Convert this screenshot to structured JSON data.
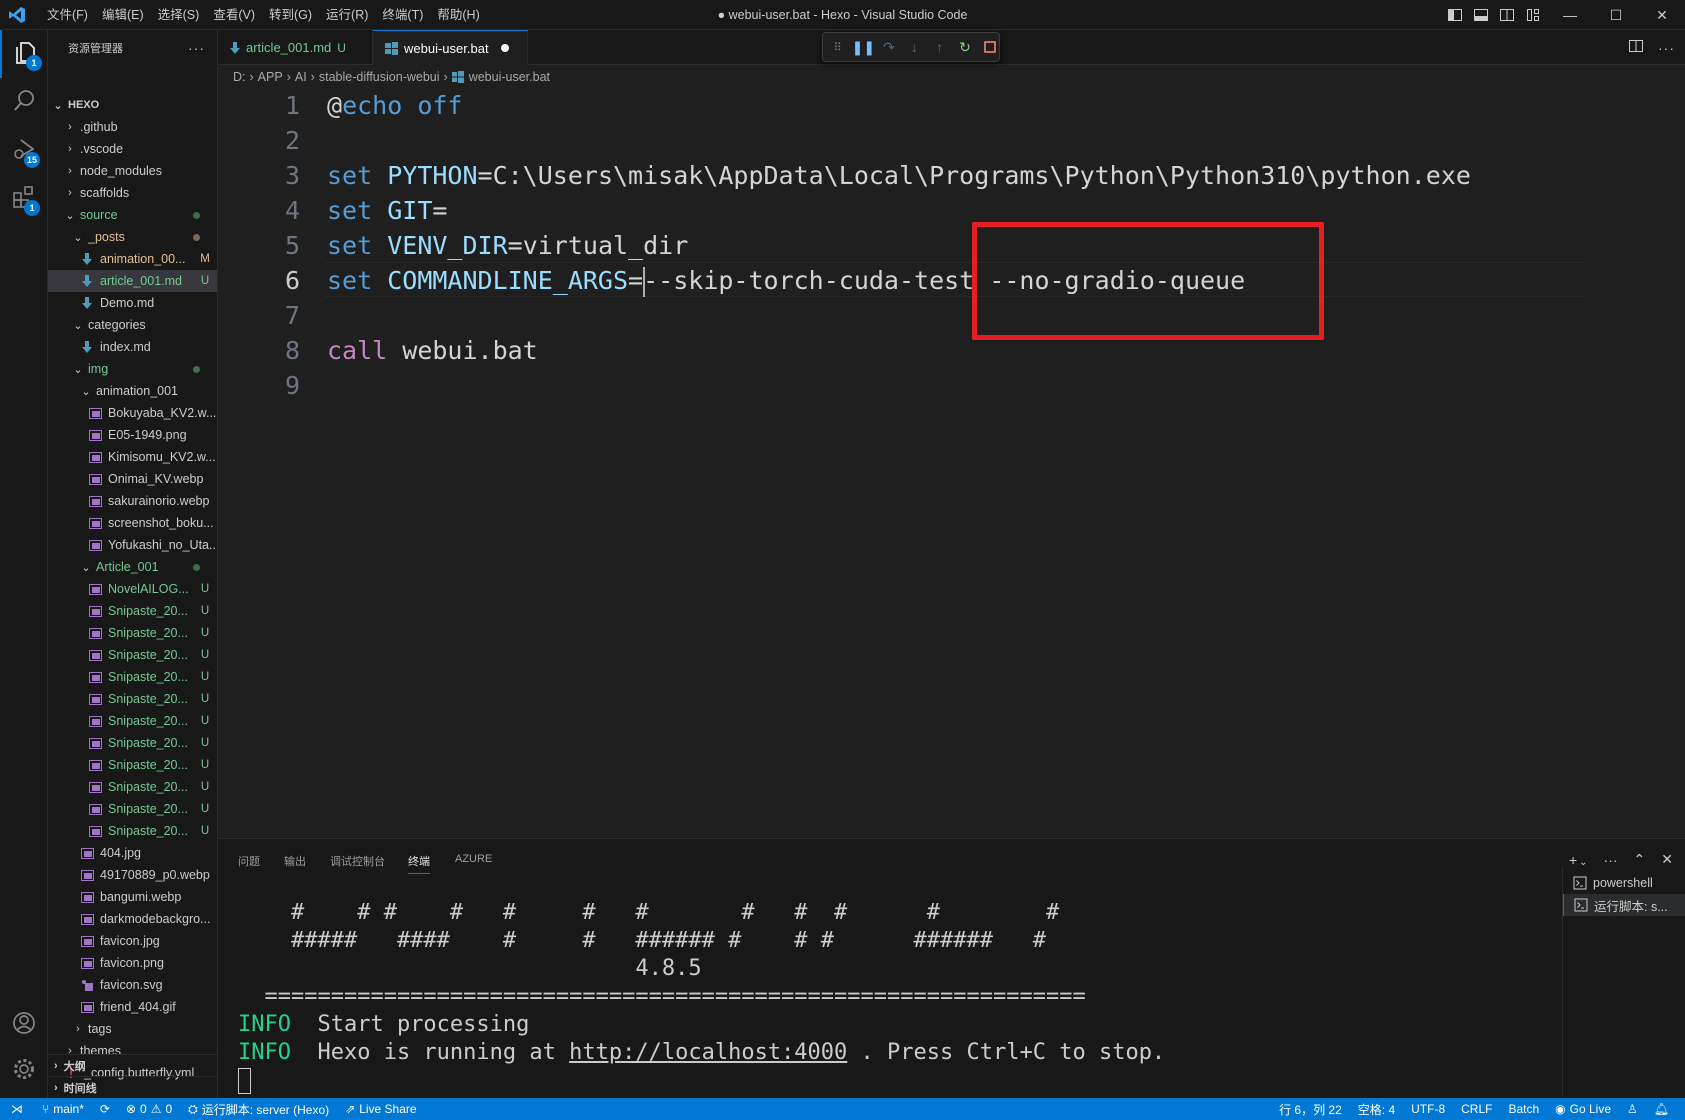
{
  "titlebar": {
    "menu": [
      "文件(F)",
      "编辑(E)",
      "选择(S)",
      "查看(V)",
      "转到(G)",
      "运行(R)",
      "终端(T)",
      "帮助(H)"
    ],
    "window_title": "● webui-user.bat - Hexo - Visual Studio Code",
    "controls": {
      "minimize": "—",
      "maximize": "☐",
      "close": "✕"
    }
  },
  "activitybar": {
    "items": [
      {
        "icon": "files-icon",
        "badge": "1"
      },
      {
        "icon": "search-icon",
        "badge": ""
      },
      {
        "icon": "run-debug-icon",
        "badge": "15"
      },
      {
        "icon": "extensions-icon",
        "badge": "1"
      }
    ],
    "bottom": [
      {
        "icon": "account-icon"
      },
      {
        "icon": "gear-icon"
      }
    ]
  },
  "sidebar": {
    "title": "资源管理器",
    "more": "···",
    "root": "HEXO",
    "tree": [
      {
        "label": ".github",
        "type": "folder",
        "open": false,
        "depth": 1
      },
      {
        "label": ".vscode",
        "type": "folder",
        "open": false,
        "depth": 1
      },
      {
        "label": "node_modules",
        "type": "folder",
        "open": false,
        "depth": 1
      },
      {
        "label": "scaffolds",
        "type": "folder",
        "open": false,
        "depth": 1
      },
      {
        "label": "source",
        "type": "folder",
        "open": true,
        "depth": 1,
        "color": "green",
        "dot": "green"
      },
      {
        "label": "_posts",
        "type": "folder",
        "open": true,
        "depth": 2,
        "color": "yellow",
        "dot": "yellow"
      },
      {
        "label": "animation_00...",
        "type": "md",
        "depth": 3,
        "color": "yellow",
        "status": "M"
      },
      {
        "label": "article_001.md",
        "type": "md",
        "depth": 3,
        "color": "green",
        "status": "U",
        "selected": true
      },
      {
        "label": "Demo.md",
        "type": "md",
        "depth": 3
      },
      {
        "label": "categories",
        "type": "folder",
        "open": true,
        "depth": 2
      },
      {
        "label": "index.md",
        "type": "md",
        "depth": 3
      },
      {
        "label": "img",
        "type": "folder",
        "open": true,
        "depth": 2,
        "color": "green",
        "dot": "green"
      },
      {
        "label": "animation_001",
        "type": "folder",
        "open": true,
        "depth": 3
      },
      {
        "label": "Bokuyaba_KV2.w...",
        "type": "image",
        "depth": 4
      },
      {
        "label": "E05-1949.png",
        "type": "image",
        "depth": 4
      },
      {
        "label": "Kimisomu_KV2.w...",
        "type": "image",
        "depth": 4
      },
      {
        "label": "Onimai_KV.webp",
        "type": "image",
        "depth": 4
      },
      {
        "label": "sakurainorio.webp",
        "type": "image",
        "depth": 4
      },
      {
        "label": "screenshot_boku...",
        "type": "image",
        "depth": 4
      },
      {
        "label": "Yofukashi_no_Uta...",
        "type": "image",
        "depth": 4
      },
      {
        "label": "Article_001",
        "type": "folder",
        "open": true,
        "depth": 3,
        "color": "green",
        "dot": "green"
      },
      {
        "label": "NovelAILOG...",
        "type": "image",
        "depth": 4,
        "color": "green",
        "status": "U"
      },
      {
        "label": "Snipaste_20...",
        "type": "image",
        "depth": 4,
        "color": "green",
        "status": "U"
      },
      {
        "label": "Snipaste_20...",
        "type": "image",
        "depth": 4,
        "color": "green",
        "status": "U"
      },
      {
        "label": "Snipaste_20...",
        "type": "image",
        "depth": 4,
        "color": "green",
        "status": "U"
      },
      {
        "label": "Snipaste_20...",
        "type": "image",
        "depth": 4,
        "color": "green",
        "status": "U"
      },
      {
        "label": "Snipaste_20...",
        "type": "image",
        "depth": 4,
        "color": "green",
        "status": "U"
      },
      {
        "label": "Snipaste_20...",
        "type": "image",
        "depth": 4,
        "color": "green",
        "status": "U"
      },
      {
        "label": "Snipaste_20...",
        "type": "image",
        "depth": 4,
        "color": "green",
        "status": "U"
      },
      {
        "label": "Snipaste_20...",
        "type": "image",
        "depth": 4,
        "color": "green",
        "status": "U"
      },
      {
        "label": "Snipaste_20...",
        "type": "image",
        "depth": 4,
        "color": "green",
        "status": "U"
      },
      {
        "label": "Snipaste_20...",
        "type": "image",
        "depth": 4,
        "color": "green",
        "status": "U"
      },
      {
        "label": "Snipaste_20...",
        "type": "image",
        "depth": 4,
        "color": "green",
        "status": "U"
      },
      {
        "label": "404.jpg",
        "type": "image",
        "depth": 3
      },
      {
        "label": "49170889_p0.webp",
        "type": "image",
        "depth": 3
      },
      {
        "label": "bangumi.webp",
        "type": "image",
        "depth": 3
      },
      {
        "label": "darkmodebackgro...",
        "type": "image",
        "depth": 3
      },
      {
        "label": "favicon.jpg",
        "type": "image",
        "depth": 3
      },
      {
        "label": "favicon.png",
        "type": "image",
        "depth": 3
      },
      {
        "label": "favicon.svg",
        "type": "svg",
        "depth": 3
      },
      {
        "label": "friend_404.gif",
        "type": "image",
        "depth": 3
      },
      {
        "label": "tags",
        "type": "folder",
        "open": false,
        "depth": 2
      },
      {
        "label": "themes",
        "type": "folder",
        "open": false,
        "depth": 1
      },
      {
        "label": "_config.butterfly.yml",
        "type": "yml",
        "depth": 1
      }
    ],
    "sections": [
      "大纲",
      "时间线"
    ]
  },
  "tabs": [
    {
      "label": "article_001.md",
      "status": "U",
      "active": false
    },
    {
      "label": "webui-user.bat",
      "dirty": true,
      "active": true
    }
  ],
  "breadcrumb": [
    "D:",
    "APP",
    "AI",
    "stable-diffusion-webui",
    "webui-user.bat"
  ],
  "editor": {
    "lines": [
      {
        "n": "1",
        "tokens": [
          {
            "t": "@",
            "c": "txt"
          },
          {
            "t": "echo off",
            "c": "kw"
          }
        ]
      },
      {
        "n": "2",
        "tokens": []
      },
      {
        "n": "3",
        "tokens": [
          {
            "t": "set ",
            "c": "kw"
          },
          {
            "t": "PYTHON",
            "c": "var"
          },
          {
            "t": "=C:\\Users\\misak\\AppData\\Local\\Programs\\Python\\Python310\\python.exe",
            "c": "txt"
          }
        ]
      },
      {
        "n": "4",
        "tokens": [
          {
            "t": "set ",
            "c": "kw"
          },
          {
            "t": "GIT",
            "c": "var"
          },
          {
            "t": "=",
            "c": "txt"
          }
        ]
      },
      {
        "n": "5",
        "tokens": [
          {
            "t": "set ",
            "c": "kw"
          },
          {
            "t": "VENV_DIR",
            "c": "var"
          },
          {
            "t": "=virtual_dir",
            "c": "txt"
          }
        ]
      },
      {
        "n": "6",
        "tokens": [
          {
            "t": "set ",
            "c": "kw"
          },
          {
            "t": "COMMANDLINE_ARGS",
            "c": "var"
          },
          {
            "t": "=",
            "c": "txt"
          },
          {
            "t": "",
            "c": "cursor"
          },
          {
            "t": "--skip-torch-cuda-test --no-gradio-queue",
            "c": "txt"
          }
        ],
        "current": true
      },
      {
        "n": "7",
        "tokens": []
      },
      {
        "n": "8",
        "tokens": [
          {
            "t": "call",
            "c": "call"
          },
          {
            "t": " webui.bat",
            "c": "txt"
          }
        ]
      },
      {
        "n": "9",
        "tokens": []
      }
    ],
    "annotation_color": "#e81e25"
  },
  "panel": {
    "tabs": [
      "问题",
      "输出",
      "调试控制台",
      "终端",
      "AZURE"
    ],
    "active_tab": "终端",
    "terminal": [
      {
        "text": "    #    # #    #   #     #   #       #   #  #      #        #",
        "kind": "plain"
      },
      {
        "text": "    #####   ####    #     #   ###### #    # #      ######   #",
        "kind": "plain"
      },
      {
        "text": "                              4.8.5",
        "kind": "plain"
      },
      {
        "text": "  ==============================================================",
        "kind": "plain"
      },
      {
        "prefix": "INFO",
        "text": "  Start processing",
        "kind": "info"
      },
      {
        "prefix": "INFO",
        "text": "  Hexo is running at ",
        "link": "http://localhost:4000",
        "suffix": " . Press Ctrl+C to stop.",
        "kind": "info-link"
      }
    ],
    "terminals": [
      {
        "label": "powershell",
        "active": false
      },
      {
        "label": "运行脚本: s...",
        "active": true
      }
    ]
  },
  "statusbar": {
    "branch": "main*",
    "errors": "0",
    "warnings": "0",
    "task": "运行脚本: server (Hexo)",
    "liveshare": "Live Share",
    "position": "行 6，列 22",
    "spaces": "空格: 4",
    "encoding": "UTF-8",
    "eol": "CRLF",
    "language": "Batch",
    "golive": "Go Live"
  },
  "colors": {
    "accent": "#0078d4",
    "git_untracked": "#73c991",
    "git_modified": "#e2c08d",
    "annotation": "#e81e25"
  }
}
